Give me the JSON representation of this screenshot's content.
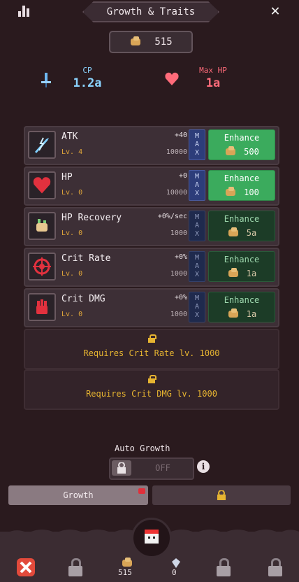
{
  "header": {
    "title": "Growth & Traits",
    "close_icon": "close-icon",
    "stats_icon": "bar-chart-icon"
  },
  "currency": {
    "icon": "bread-coin-icon",
    "amount": "515"
  },
  "stats": {
    "cp": {
      "label": "CP",
      "value": "1.2a",
      "color": "#8bd4ff"
    },
    "max_hp": {
      "label": "Max HP",
      "value": "1a",
      "color": "#ff6b7a"
    }
  },
  "rows": [
    {
      "name": "ATK",
      "level": "Lv. 4",
      "bonus": "+40",
      "max": "10000",
      "enhance_label": "Enhance",
      "cost": "500",
      "icon": "lightning-sword-icon",
      "affordable": true
    },
    {
      "name": "HP",
      "level": "Lv. 0",
      "bonus": "+0",
      "max": "10000",
      "enhance_label": "Enhance",
      "cost": "100",
      "icon": "heart-icon",
      "affordable": true
    },
    {
      "name": "HP Recovery",
      "level": "Lv. 0",
      "bonus": "+0%/sec",
      "max": "1000",
      "enhance_label": "Enhance",
      "cost": "5a",
      "icon": "healing-hand-icon",
      "affordable": false
    },
    {
      "name": "Crit Rate",
      "level": "Lv. 0",
      "bonus": "+0%",
      "max": "1000",
      "enhance_label": "Enhance",
      "cost": "1a",
      "icon": "crosshair-icon",
      "affordable": false
    },
    {
      "name": "Crit DMG",
      "level": "Lv. 0",
      "bonus": "+0%",
      "max": "1000",
      "enhance_label": "Enhance",
      "cost": "1a",
      "icon": "crit-hand-icon",
      "affordable": false
    }
  ],
  "max_button_letters": [
    "M",
    "A",
    "X"
  ],
  "locked_rows": [
    {
      "text": "Requires Crit Rate lv. 1000"
    },
    {
      "text": "Requires Crit DMG lv. 1000"
    }
  ],
  "auto_growth": {
    "label": "Auto Growth",
    "state": "OFF"
  },
  "tabs": {
    "growth": "Growth"
  },
  "bottom_nav": {
    "coin_count": "515",
    "gem_count": "0"
  },
  "colors": {
    "accent_green": "#3bab5d",
    "accent_gold": "#e6b431",
    "max_blue": "#2d3d7a"
  }
}
